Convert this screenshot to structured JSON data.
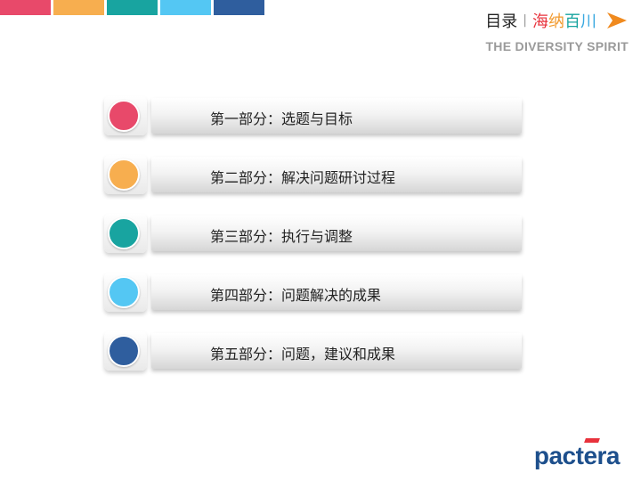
{
  "topbar": {
    "colors": [
      "#e8496a",
      "#f7ae4f",
      "#18a4a0",
      "#54c7f3",
      "#2f5e9e"
    ]
  },
  "header": {
    "title": "目录",
    "separator": "|",
    "brand": [
      {
        "text": "海",
        "color": "#e8323c"
      },
      {
        "text": "纳",
        "color": "#f29a2e"
      },
      {
        "text": "百",
        "color": "#18a4a0"
      },
      {
        "text": "川",
        "color": "#39a8e0"
      }
    ],
    "arrow_color": "#f08a1e",
    "tagline": "THE DIVERSITY SPIRIT"
  },
  "agenda": [
    {
      "label": "第一部分：选题与目标",
      "color": "#e8496a"
    },
    {
      "label": "第二部分：解决问题研讨过程",
      "color": "#f7ae4f"
    },
    {
      "label": "第三部分：执行与调整",
      "color": "#18a4a0"
    },
    {
      "label": "第四部分：问题解决的成果",
      "color": "#54c7f3"
    },
    {
      "label": "第五部分：问题，建议和成果",
      "color": "#2f5e9e"
    }
  ],
  "logo": {
    "prefix": "pact",
    "accent": "e",
    "suffix": "ra"
  }
}
